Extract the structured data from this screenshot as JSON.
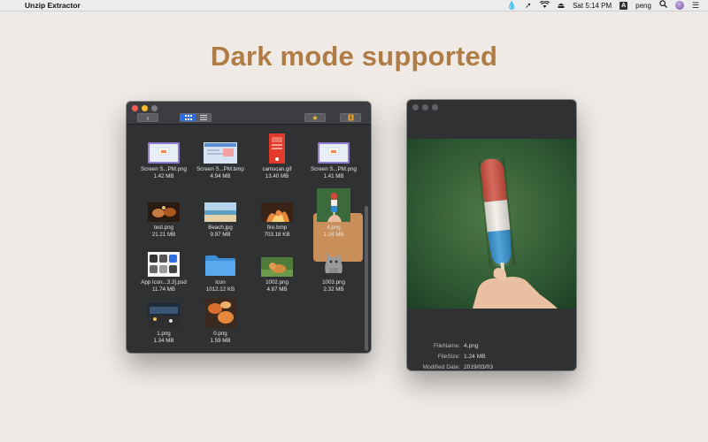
{
  "menubar": {
    "app_name": "Unzip Extractor",
    "clock": "Sat 5:14 PM",
    "input_source": "A",
    "user": "peng"
  },
  "headline": "Dark mode supported",
  "browser": {
    "selected_index": 7,
    "files": [
      {
        "name": "Screen S...PM.png",
        "size": "1.42 MB",
        "thumb": "screenshot"
      },
      {
        "name": "Screen S...PM.bmp",
        "size": "4.94 MB",
        "thumb": "screenshot-blue"
      },
      {
        "name": "camscan.gif",
        "size": "13.40 MB",
        "thumb": "phone-red"
      },
      {
        "name": "Screen S...PM.png",
        "size": "1.41 MB",
        "thumb": "screenshot"
      },
      {
        "name": "test.png",
        "size": "21.21 MB",
        "thumb": "food-dark"
      },
      {
        "name": "Beach.jpg",
        "size": "9.97 MB",
        "thumb": "beach"
      },
      {
        "name": "fire.bmp",
        "size": "703.18 KB",
        "thumb": "fire"
      },
      {
        "name": "4.png",
        "size": "1.24 MB",
        "thumb": "popsicle"
      },
      {
        "name": "App Icon...3.3].psd",
        "size": "11.74 MB",
        "thumb": "app-icons"
      },
      {
        "name": "icon",
        "size": "1012.12 KB",
        "thumb": "folder"
      },
      {
        "name": "1002.png",
        "size": "4.87 MB",
        "thumb": "cat-grass"
      },
      {
        "name": "1003.png",
        "size": "2.32 MB",
        "thumb": "cat-sticker"
      },
      {
        "name": "1.png",
        "size": "1.34 MB",
        "thumb": "street"
      },
      {
        "name": "0.png",
        "size": "1.59 MB",
        "thumb": "food-orange"
      }
    ]
  },
  "preview": {
    "filename_label": "FileName:",
    "filename": "4.png",
    "filesize_label": "FileSize:",
    "filesize": "1.24 MB",
    "modified_label": "Modified Date:",
    "modified": "2019/03/03"
  },
  "colors": {
    "headline": "#b07c45",
    "selection": "#c98f5a",
    "window_bg": "#2f3133",
    "close": "#ff5f57",
    "minimize": "#febc2e",
    "zoom_inactive": "#7d7f82"
  }
}
